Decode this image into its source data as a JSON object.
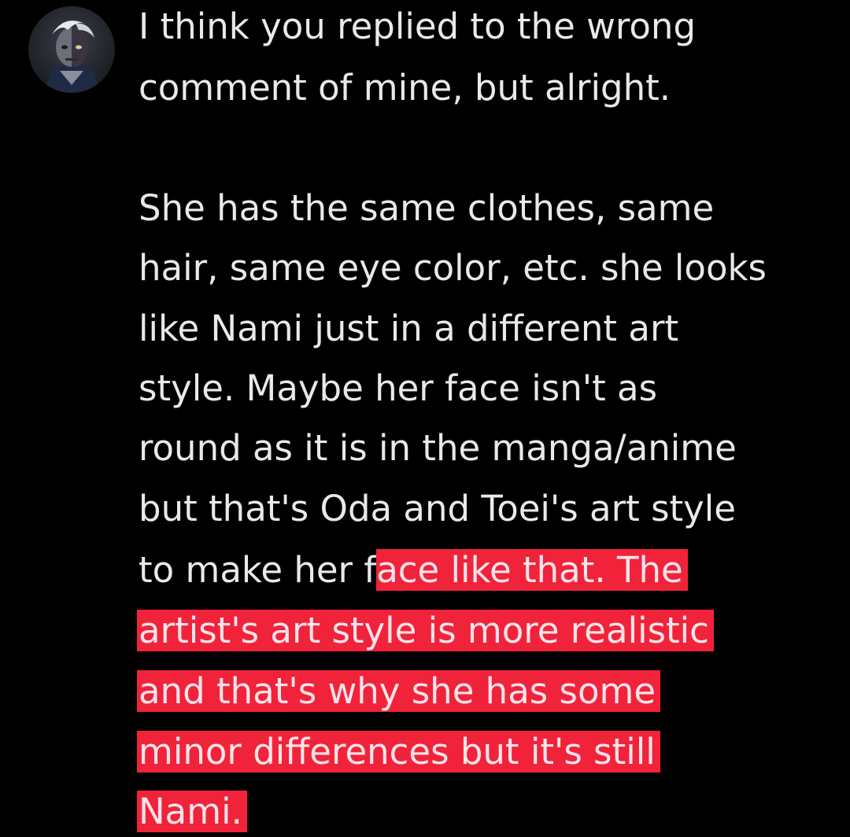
{
  "comment": {
    "lines": [
      {
        "text": "I think you replied to the wrong"
      },
      {
        "text": "comment of mine, but alright."
      },
      {
        "text": "She has the same clothes, same"
      },
      {
        "text": "hair, same eye color, etc. she looks"
      },
      {
        "text": "like Nami just in a different art"
      },
      {
        "text": "style. Maybe her face isn't as"
      },
      {
        "text": "round as it is in the manga/anime"
      },
      {
        "text": "but that's Oda and Toei's art style"
      },
      {
        "text": "to make her f",
        "highlight": "ace like that. The"
      },
      {
        "highlight": "artist's art style is more realistic"
      },
      {
        "highlight": "and that's why she has some"
      },
      {
        "highlight": "minor differences but it's still"
      },
      {
        "highlight": "Nami."
      }
    ]
  },
  "colors": {
    "background": "#000000",
    "text": "#e7e9ea",
    "highlight": "#f0233a"
  }
}
